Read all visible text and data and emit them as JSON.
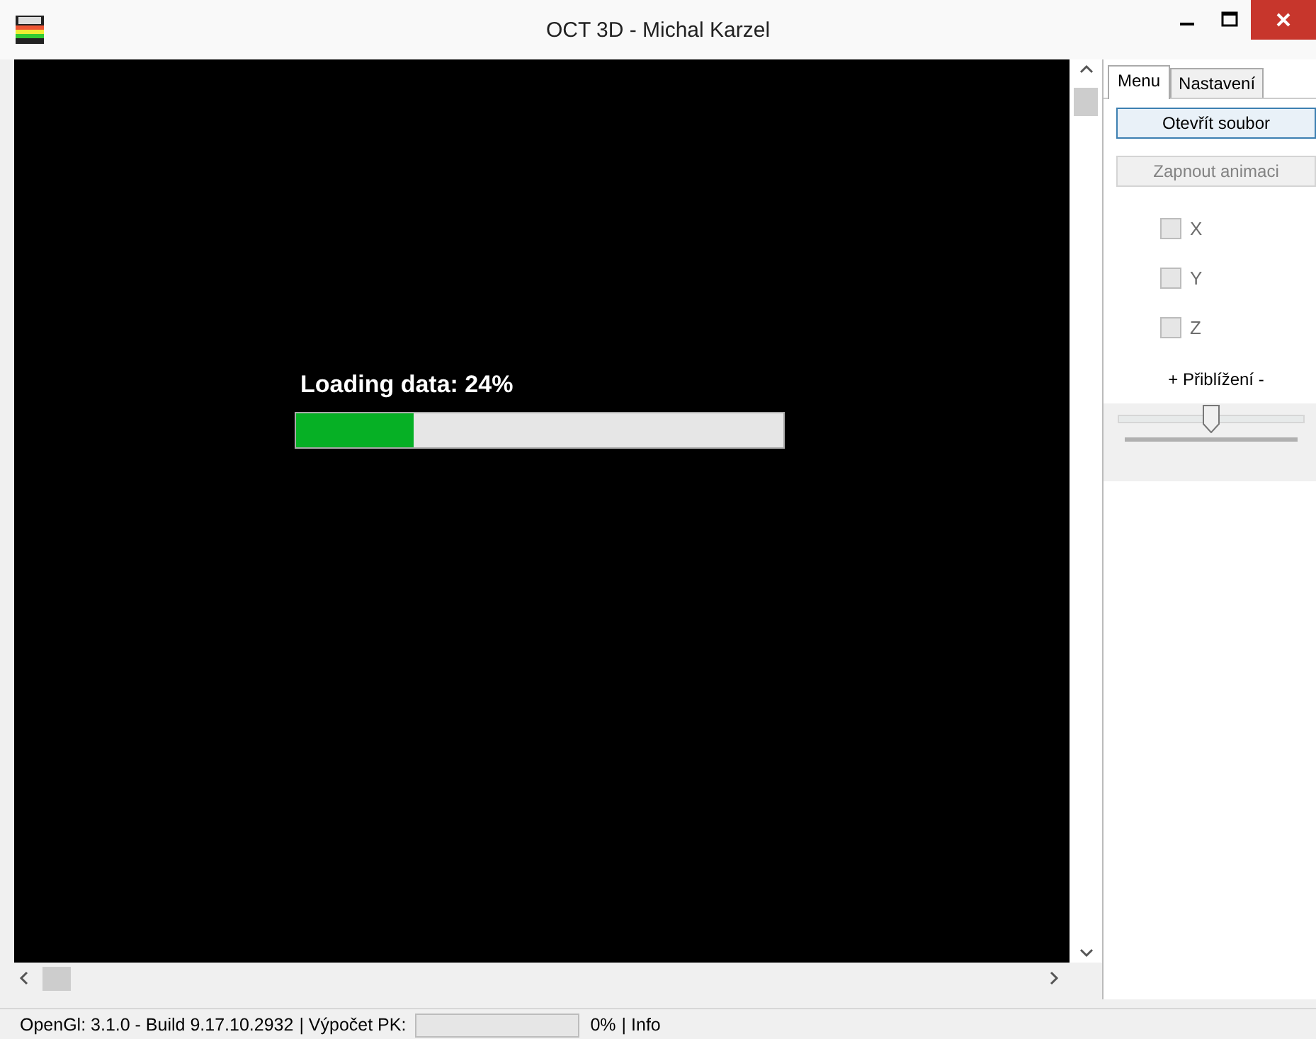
{
  "window": {
    "title": "OCT 3D - Michal Karzel"
  },
  "viewport": {
    "loading_text": "Loading data: 24%",
    "level": 0.24
  },
  "tabs": [
    {
      "label": "Menu",
      "selected": true
    },
    {
      "label": "Nastavení",
      "selected": false
    }
  ],
  "buttons": [
    {
      "label": "Otevřít soubor",
      "disabled": false
    },
    {
      "label": "Zapnout animaci",
      "disabled": true
    }
  ],
  "checkboxes": [
    {
      "label": "X",
      "checked": false,
      "disabled": true
    },
    {
      "label": "Y",
      "checked": false,
      "disabled": true
    },
    {
      "label": "Z",
      "checked": false,
      "disabled": true
    }
  ],
  "zoom": {
    "label": "+ Přiblížení -",
    "level": 0.5
  },
  "status_bar": {
    "opengl": "OpenGl:  3.1.0 - Build 9.17.10.2932",
    "calc_label": "| Výpočet PK:",
    "calc_progress": {
      "level": 0
    },
    "calc_percent": "0%",
    "info": "| Info"
  }
}
